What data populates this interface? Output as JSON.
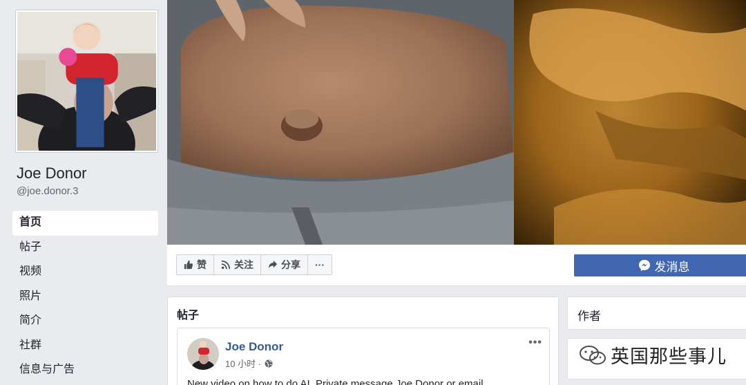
{
  "profile": {
    "name": "Joe Donor",
    "handle": "@joe.donor.3"
  },
  "nav": {
    "items": [
      {
        "label": "首页"
      },
      {
        "label": "帖子"
      },
      {
        "label": "视频"
      },
      {
        "label": "照片"
      },
      {
        "label": "简介"
      },
      {
        "label": "社群"
      },
      {
        "label": "信息与广告"
      }
    ]
  },
  "actions": {
    "like": "赞",
    "follow": "关注",
    "share": "分享",
    "more": "···",
    "message": "发消息"
  },
  "posts": {
    "section_title": "帖子",
    "post": {
      "author": "Joe Donor",
      "time": "10 小时 ·",
      "more": "•••",
      "text": "New video on how to do AI. Private message Joe Donor or email"
    }
  },
  "right": {
    "author_title": "作者"
  },
  "watermark": {
    "text": "英国那些事儿"
  },
  "colors": {
    "facebook_blue": "#4267b2",
    "link_blue": "#365899",
    "background": "#e9ebee"
  },
  "icons": [
    "thumbs-up-icon",
    "rss-icon",
    "share-arrow-icon",
    "messenger-icon",
    "globe-icon",
    "wechat-icon"
  ]
}
